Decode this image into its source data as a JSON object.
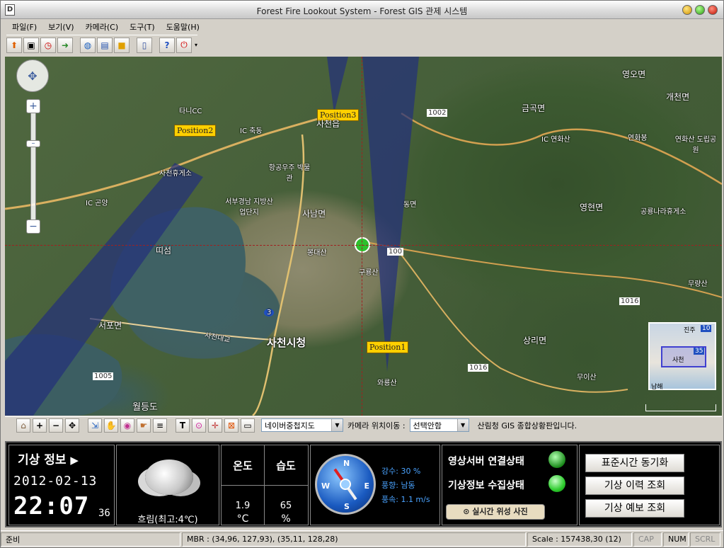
{
  "window": {
    "title": "Forest Fire Lookout System - Forest GIS 관제 시스템",
    "app_icon": "D"
  },
  "menu": [
    "파일(F)",
    "보기(V)",
    "카메라(C)",
    "도구(T)",
    "도움말(H)"
  ],
  "toolbar_icons": [
    "upload-icon",
    "camera-icon",
    "stopwatch-icon",
    "export-icon",
    "globe-icon",
    "printer-icon",
    "folder-icon",
    "device-icon",
    "help-icon",
    "power-icon"
  ],
  "map": {
    "flags": [
      {
        "label": "Position1"
      },
      {
        "label": "Position2"
      },
      {
        "label": "Position3"
      }
    ],
    "labels": {
      "sacheon_city": "사천시청",
      "saryang": "사남면",
      "bongdaesan": "봉대산",
      "gurangsan": "구룡산",
      "wawoosan": "와룡산",
      "tteoseom": "띠섬",
      "seopo": "서포면",
      "wolgdo": "월등도",
      "sacheon_bridge": "사천대교",
      "gonyang": "곤양",
      "chukdong": "축동",
      "tanilcc": "타니CC",
      "sacheon_rest": "사천휴게소",
      "aerospace": "항공우주 박물관",
      "industrial": "서부경남 지방산업단지",
      "sacheonup": "사천읍",
      "gongbi": "곤명",
      "dongmyeon": "동면",
      "geumgok": "금곡면",
      "yeonhwasan": "연화산",
      "yeonhwapark": "연화산 도립공원",
      "yeonghyeon": "영현면",
      "gongnyong": "공룡나라휴게소",
      "mooryang": "무량산",
      "sangri": "상리면",
      "muisan": "무이산",
      "yeonhwabong": "연화봉",
      "gaecheon": "개천면",
      "yeongo": "영오면",
      "r1002": "1002",
      "r1005": "1005",
      "r1016a": "1016",
      "r1016b": "1016",
      "r100": "100",
      "r3": "3",
      "ic1": "IC",
      "ic2": "IC",
      "ic3": "IC",
      "minimap_jinju": "진주",
      "minimap_10": "10",
      "minimap_35": "35",
      "minimap_sacheon": "사천",
      "minimap_namhae": "남해"
    }
  },
  "map_tools": {
    "map_type": "네이버중첩지도",
    "camera_move_label": "카메라 위치이동 :",
    "camera_select": "선택안함",
    "status_msg": "산림청 GIS 종합상황판입니다."
  },
  "weather": {
    "title": "기상 정보",
    "date": "2012-02-13",
    "time": "22:07",
    "seconds": "36",
    "condition": "흐림(최고:4℃)",
    "temp_head": "온도",
    "humid_head": "습도",
    "temp_val": "1.9",
    "temp_unit": "°C",
    "humid_val": "65",
    "humid_unit": "%",
    "precip": "강수: 30 %",
    "wind_dir": "풍향: 남동",
    "wind_speed": "풍속: 1.1 m/s",
    "compass": {
      "n": "N",
      "e": "E",
      "s": "S",
      "w": "W"
    }
  },
  "status": {
    "video_server": "영상서버 연결상태",
    "weather_collect": "기상정보 수집상태",
    "satellite_btn": "실시간 위성 사진",
    "led_color": "#2ecc2e"
  },
  "buttons": {
    "sync_time": "표준시간 동기화",
    "weather_history": "기상 이력 조회",
    "weather_forecast": "기상 예보 조회"
  },
  "statusbar": {
    "ready": "준비",
    "mbr": "MBR : (34,96, 127,93), (35,11, 128,28)",
    "scale": "Scale : 157438,30 (12)",
    "cap": "CAP",
    "num": "NUM",
    "scrl": "SCRL"
  }
}
